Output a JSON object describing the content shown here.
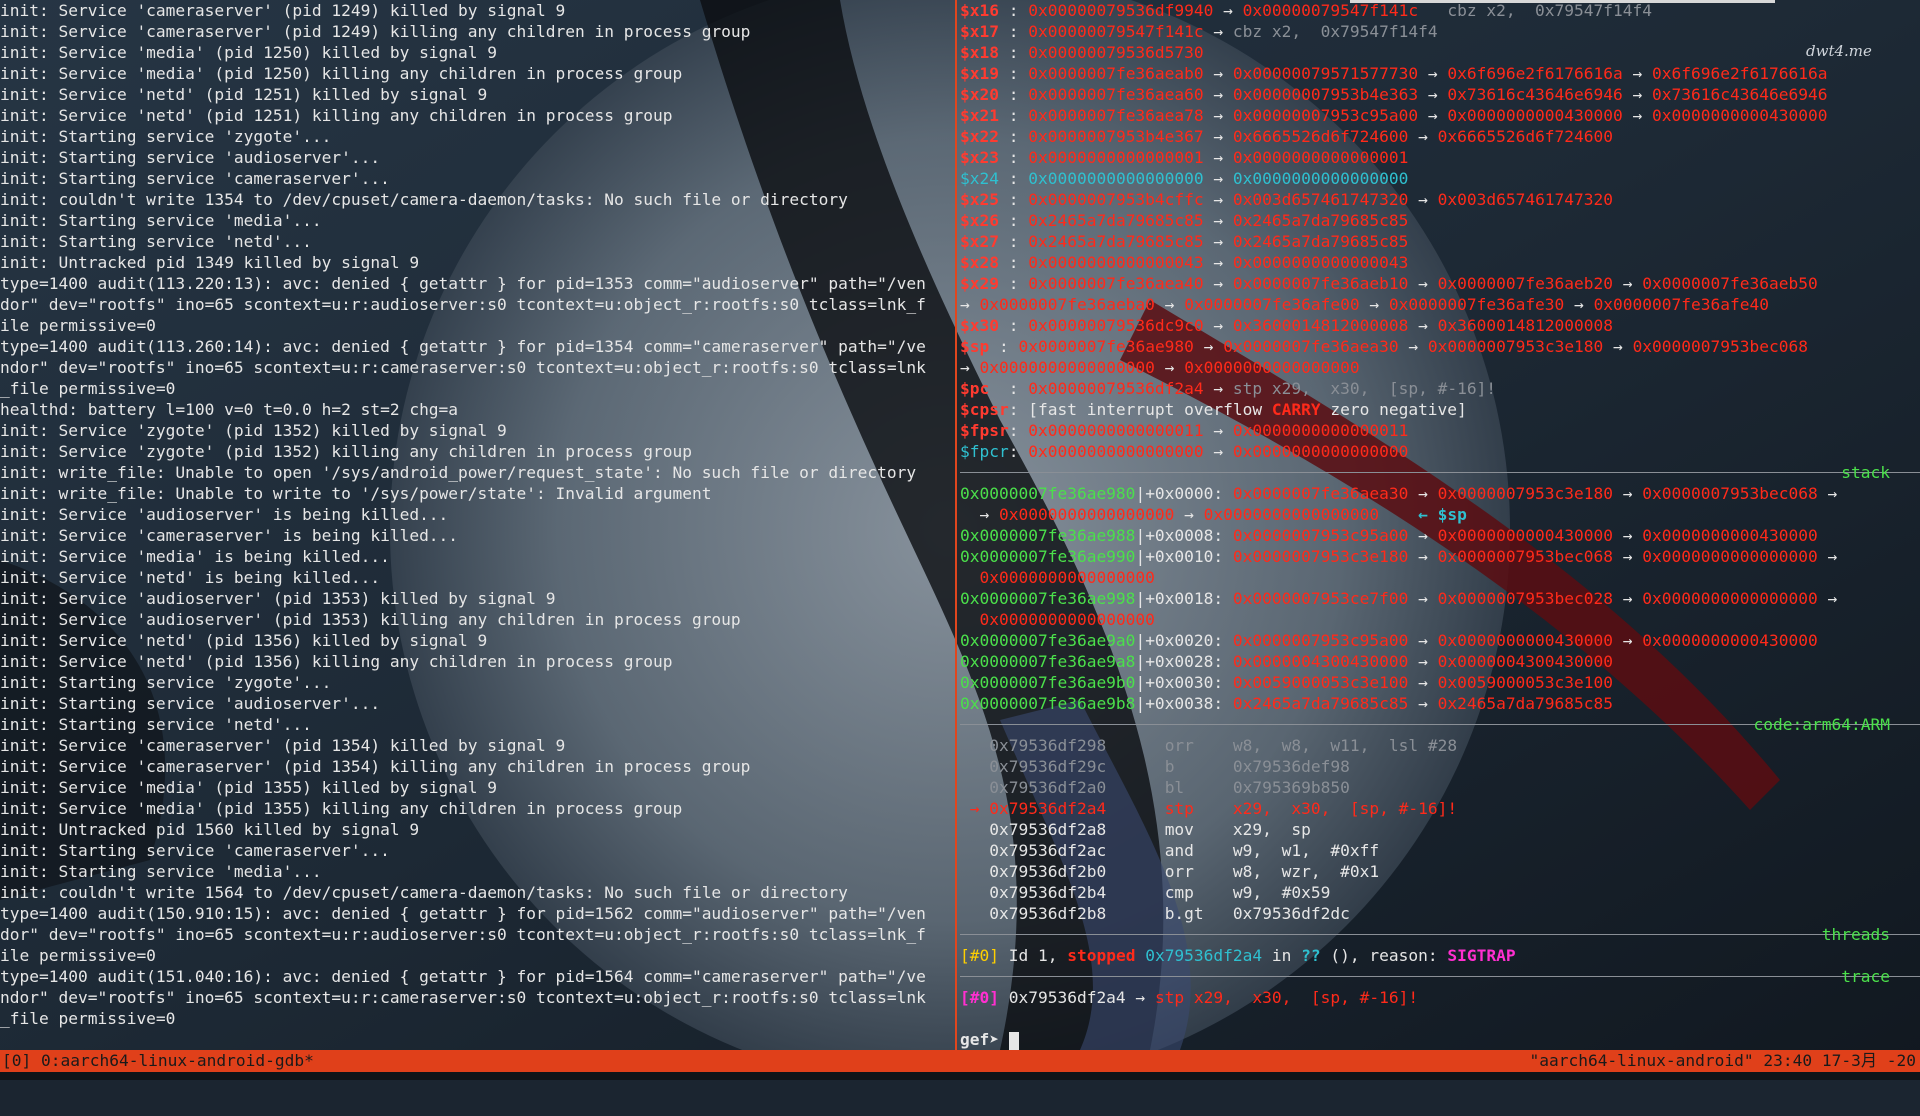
{
  "left_log": [
    "init: Service 'cameraserver' (pid 1249) killed by signal 9",
    "init: Service 'cameraserver' (pid 1249) killing any children in process group",
    "init: Service 'media' (pid 1250) killed by signal 9",
    "init: Service 'media' (pid 1250) killing any children in process group",
    "init: Service 'netd' (pid 1251) killed by signal 9",
    "init: Service 'netd' (pid 1251) killing any children in process group",
    "init: Starting service 'zygote'...",
    "init: Starting service 'audioserver'...",
    "init: Starting service 'cameraserver'...",
    "init: couldn't write 1354 to /dev/cpuset/camera-daemon/tasks: No such file or directory",
    "init: Starting service 'media'...",
    "init: Starting service 'netd'...",
    "init: Untracked pid 1349 killed by signal 9",
    "type=1400 audit(113.220:13): avc: denied { getattr } for pid=1353 comm=\"audioserver\" path=\"/ven",
    "dor\" dev=\"rootfs\" ino=65 scontext=u:r:audioserver:s0 tcontext=u:object_r:rootfs:s0 tclass=lnk_f",
    "ile permissive=0",
    "type=1400 audit(113.260:14): avc: denied { getattr } for pid=1354 comm=\"cameraserver\" path=\"/ve",
    "ndor\" dev=\"rootfs\" ino=65 scontext=u:r:cameraserver:s0 tcontext=u:object_r:rootfs:s0 tclass=lnk",
    "_file permissive=0",
    "healthd: battery l=100 v=0 t=0.0 h=2 st=2 chg=a",
    "init: Service 'zygote' (pid 1352) killed by signal 9",
    "init: Service 'zygote' (pid 1352) killing any children in process group",
    "init: write_file: Unable to open '/sys/android_power/request_state': No such file or directory",
    "init: write_file: Unable to write to '/sys/power/state': Invalid argument",
    "init: Service 'audioserver' is being killed...",
    "init: Service 'cameraserver' is being killed...",
    "init: Service 'media' is being killed...",
    "init: Service 'netd' is being killed...",
    "init: Service 'audioserver' (pid 1353) killed by signal 9",
    "init: Service 'audioserver' (pid 1353) killing any children in process group",
    "init: Service 'netd' (pid 1356) killed by signal 9",
    "init: Service 'netd' (pid 1356) killing any children in process group",
    "init: Starting service 'zygote'...",
    "init: Starting service 'audioserver'...",
    "init: Starting service 'netd'...",
    "init: Service 'cameraserver' (pid 1354) killed by signal 9",
    "init: Service 'cameraserver' (pid 1354) killing any children in process group",
    "init: Service 'media' (pid 1355) killed by signal 9",
    "init: Service 'media' (pid 1355) killing any children in process group",
    "init: Untracked pid 1560 killed by signal 9",
    "init: Starting service 'cameraserver'...",
    "init: Starting service 'media'...",
    "init: couldn't write 1564 to /dev/cpuset/camera-daemon/tasks: No such file or directory",
    "type=1400 audit(150.910:15): avc: denied { getattr } for pid=1562 comm=\"audioserver\" path=\"/ven",
    "dor\" dev=\"rootfs\" ino=65 scontext=u:r:audioserver:s0 tcontext=u:object_r:rootfs:s0 tclass=lnk_f",
    "ile permissive=0",
    "type=1400 audit(151.040:16): avc: denied { getattr } for pid=1564 comm=\"cameraserver\" path=\"/ve",
    "ndor\" dev=\"rootfs\" ino=65 scontext=u:r:cameraserver:s0 tcontext=u:object_r:rootfs:s0 tclass=lnk",
    "_file permissive=0"
  ],
  "registers": [
    {
      "name": "$x16",
      "val": "0x00000079536df9940",
      "chain": [
        "0x00000079547f141c"
      ],
      "comment": "cbz x2,  0x79547f14f4",
      "cyan": false
    },
    {
      "name": "$x17",
      "val": "0x00000079547f141c",
      "chain": [],
      "comment": "cbz x2,  0x79547f14f4",
      "cyan": false
    },
    {
      "name": "$x18",
      "val": "0x00000079536d5730",
      "chain": [],
      "comment": "",
      "cyan": false
    },
    {
      "name": "$x19",
      "val": "0x0000007fe36aeab0",
      "chain": [
        "0x00000079571577730",
        "0x6f696e2f6176616a",
        "0x6f696e2f6176616a"
      ],
      "comment": "",
      "cyan": false
    },
    {
      "name": "$x20",
      "val": "0x0000007fe36aea60",
      "chain": [
        "0x00000007953b4e363",
        "0x73616c43646e6946",
        "0x73616c43646e6946"
      ],
      "comment": "",
      "cyan": false
    },
    {
      "name": "$x21",
      "val": "0x0000007fe36aea78",
      "chain": [
        "0x00000007953c95a00",
        "0x0000000000430000",
        "0x0000000000430000"
      ],
      "comment": "",
      "cyan": false
    },
    {
      "name": "$x22",
      "val": "0x0000007953b4e367",
      "chain": [
        "0x6665526d6f724600",
        "0x6665526d6f724600"
      ],
      "comment": "",
      "cyan": false
    },
    {
      "name": "$x23",
      "val": "0x0000000000000001",
      "chain": [
        "0x0000000000000001"
      ],
      "comment": "",
      "cyan": false
    },
    {
      "name": "$x24",
      "val": "0x0000000000000000",
      "chain": [
        "0x0000000000000000"
      ],
      "comment": "",
      "cyan": true
    },
    {
      "name": "$x25",
      "val": "0x0000007953b4cffc",
      "chain": [
        "0x003d657461747320",
        "0x003d657461747320"
      ],
      "comment": "",
      "cyan": false
    },
    {
      "name": "$x26",
      "val": "0x2465a7da79685c85",
      "chain": [
        "0x2465a7da79685c85"
      ],
      "comment": "",
      "cyan": false
    },
    {
      "name": "$x27",
      "val": "0x2465a7da79685c85",
      "chain": [
        "0x2465a7da79685c85"
      ],
      "comment": "",
      "cyan": false
    },
    {
      "name": "$x28",
      "val": "0x0000000000000043",
      "chain": [
        "0x0000000000000043"
      ],
      "comment": "",
      "cyan": false
    },
    {
      "name": "$x29",
      "val": "0x0000007fe36aea40",
      "chain": [
        "0x0000007fe36aeb10",
        "0x0000007fe36aeb20",
        "0x0000007fe36aeb50"
      ],
      "comment": "",
      "cyan": false
    }
  ],
  "x29_wrap": [
    "0x0000007fe36aeba0",
    "0x0000007fe36afe00",
    "0x0000007fe36afe30",
    "0x0000007fe36afe40"
  ],
  "registers2": [
    {
      "name": "$x30",
      "val": "0x00000079536dc9c0",
      "chain": [
        "0x3600014812000008",
        "0x3600014812000008"
      ]
    },
    {
      "name": "$sp",
      "val": "0x0000007fe36ae980",
      "chain": [
        "0x0000007fe36aea30",
        "0x0000007953c3e180",
        "0x0000007953bec068"
      ]
    }
  ],
  "sp_wrap": [
    "0x0000000000000000",
    "0x0000000000000000"
  ],
  "pc": {
    "name": "$pc",
    "val": "0x00000079536df2a4",
    "comment": "stp x29,  x30,  [sp, #-16]!"
  },
  "cpsr": {
    "name": "$cpsr",
    "pre": ": [fast interrupt overflow ",
    "carry": "CARRY",
    "post": " zero negative]"
  },
  "fpsr": {
    "name": "$fpsr",
    "val": "0x0000000000000011",
    "chain": [
      "0x0000000000000011"
    ]
  },
  "fpcr": {
    "name": "$fpcr",
    "val": "0x0000000000000000",
    "chain": [
      "0x0000000000000000"
    ]
  },
  "sections": {
    "stack": "stack",
    "code": "code:arm64:ARM",
    "threads": "threads",
    "trace": "trace"
  },
  "stack": [
    {
      "addr": "0x0000007fe36ae980",
      "off": "+0x0000:",
      "chain": [
        "0x0000007fe36aea30",
        "0x0000007953c3e180",
        "0x0000007953bec068"
      ],
      "wrap": "0x0000000000000000",
      "wrap2": "0x0000000000000000",
      "sp": "← $sp"
    },
    {
      "addr": "0x0000007fe36ae988",
      "off": "+0x0008:",
      "chain": [
        "0x0000007953c95a00",
        "0x0000000000430000",
        "0x0000000000430000"
      ]
    },
    {
      "addr": "0x0000007fe36ae990",
      "off": "+0x0010:",
      "chain": [
        "0x0000007953c3e180",
        "0x0000007953bec068",
        "0x0000000000000000"
      ],
      "wrap": "0x0000000000000000"
    },
    {
      "addr": "0x0000007fe36ae998",
      "off": "+0x0018:",
      "chain": [
        "0x0000007953ce7f00",
        "0x0000007953bec028",
        "0x0000000000000000"
      ],
      "wrap": "0x0000000000000000"
    },
    {
      "addr": "0x0000007fe36ae9a0",
      "off": "+0x0020:",
      "chain": [
        "0x0000007953c95a00",
        "0x0000000000430000",
        "0x0000000000430000"
      ]
    },
    {
      "addr": "0x0000007fe36ae9a8",
      "off": "+0x0028:",
      "chain": [
        "0x0000004300430000",
        "0x0000004300430000"
      ]
    },
    {
      "addr": "0x0000007fe36ae9b0",
      "off": "+0x0030:",
      "chain": [
        "0x0059000053c3e100",
        "0x0059000053c3e100"
      ]
    },
    {
      "addr": "0x0000007fe36ae9b8",
      "off": "+0x0038:",
      "chain": [
        "0x2465a7da79685c85",
        "0x2465a7da79685c85"
      ]
    }
  ],
  "code": [
    {
      "addr": "0x79536df298",
      "mn": "orr",
      "ops": "w8,  w8,  w11,  lsl #28",
      "state": "past"
    },
    {
      "addr": "0x79536df29c",
      "mn": "b",
      "ops": "0x79536def98",
      "state": "past"
    },
    {
      "addr": "0x79536df2a0",
      "mn": "bl",
      "ops": "0x795369b850",
      "state": "past"
    },
    {
      "addr": "0x79536df2a4",
      "mn": "stp",
      "ops": "x29,  x30,  [sp, #-16]!",
      "state": "current"
    },
    {
      "addr": "0x79536df2a8",
      "mn": "mov",
      "ops": "x29,  sp",
      "state": "next"
    },
    {
      "addr": "0x79536df2ac",
      "mn": "and",
      "ops": "w9,  w1,  #0xff",
      "state": "next"
    },
    {
      "addr": "0x79536df2b0",
      "mn": "orr",
      "ops": "w8,  wzr,  #0x1",
      "state": "next"
    },
    {
      "addr": "0x79536df2b4",
      "mn": "cmp",
      "ops": "w9,  #0x59",
      "state": "next"
    },
    {
      "addr": "0x79536df2b8",
      "mn": "b.gt",
      "ops": "0x79536df2dc",
      "state": "next"
    }
  ],
  "current_arrow": "→",
  "thread": {
    "idx": "[#0]",
    "pre": " Id 1, ",
    "stopped": "stopped",
    "addr": " 0x79536df2a4",
    "mid": " in ",
    "qq": "??",
    "post": " (), reason: ",
    "reason": "SIGTRAP"
  },
  "trace": {
    "idx": "[#0]",
    "addr": " 0x79536df2a4",
    "arrow": " → ",
    "insn": "stp x29,  x30,  [sp, #-16]!"
  },
  "prompt": "gef➤ ",
  "watermark": "dwt4.me",
  "statusbar": {
    "left": "[0] 0:aarch64-linux-android-gdb*",
    "right": "\"aarch64-linux-android\" 23:40 17-3月 -20"
  },
  "colors": {
    "accent": "#e0401a",
    "red": "#ff2a1a",
    "green": "#4be04b",
    "cyan": "#2fc0d0",
    "magenta": "#ff2fd0",
    "yellow": "#ffd000"
  }
}
